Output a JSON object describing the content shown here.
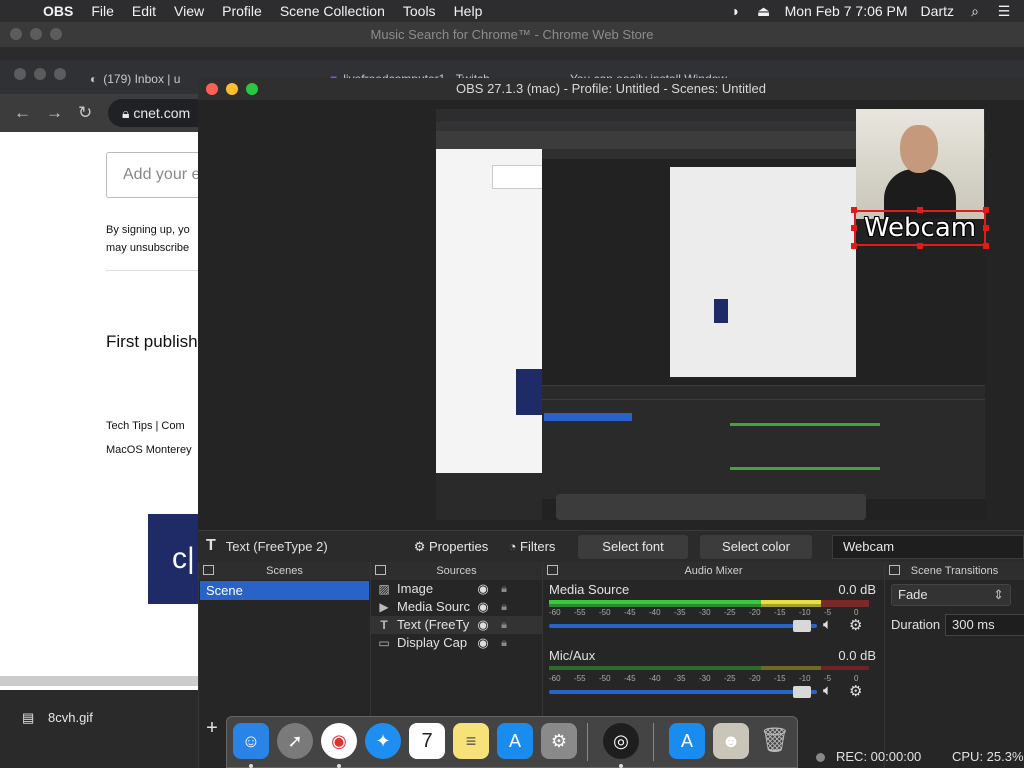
{
  "menubar": {
    "app": "OBS",
    "items": [
      "File",
      "Edit",
      "View",
      "Profile",
      "Scene Collection",
      "Tools",
      "Help"
    ],
    "datetime": "Mon Feb 7  7:06 PM",
    "user": "Dartz"
  },
  "back_window": {
    "title": "Music Search for Chrome™ - Chrome Web Store"
  },
  "chrome": {
    "tabs": [
      "(179) Inbox | u",
      "livefreedcomputer1 - Twitch",
      "You can easily install Window"
    ],
    "url": "cnet.com",
    "page": {
      "email_placeholder": "Add your e",
      "signup_line1": "By signing up, yo",
      "signup_line2": "may unsubscribe",
      "first_published": "First publish",
      "tags_line1": "Tech Tips  |  Com",
      "tags_line2": "MacOS Monterey"
    },
    "download_file": "8cvh.gif"
  },
  "obs": {
    "window_title": "OBS 27.1.3 (mac) - Profile: Untitled - Scenes: Untitled",
    "webcam_text": "Webcam",
    "selected_source": "Text (FreeType 2)",
    "buttons": {
      "properties": "Properties",
      "filters": "Filters",
      "select_font": "Select font",
      "select_color": "Select color"
    },
    "source_combo": "Webcam",
    "docks": {
      "scenes": "Scenes",
      "sources": "Sources",
      "mixer": "Audio Mixer",
      "transitions": "Scene Transitions"
    },
    "scenes": [
      "Scene"
    ],
    "sources": [
      {
        "name": "Image",
        "icon": "image-icon"
      },
      {
        "name": "Media Sourc",
        "icon": "play-icon"
      },
      {
        "name": "Text (FreeTy",
        "icon": "text-icon"
      },
      {
        "name": "Display Cap",
        "icon": "monitor-icon"
      }
    ],
    "mixer": [
      {
        "name": "Media Source",
        "db": "0.0 dB"
      },
      {
        "name": "Mic/Aux",
        "db": "0.0 dB"
      }
    ],
    "meter_ticks": [
      "-60",
      "-55",
      "-50",
      "-45",
      "-40",
      "-35",
      "-30",
      "-25",
      "-20",
      "-15",
      "-10",
      "-5",
      "0"
    ],
    "transition": "Fade",
    "duration_label": "Duration",
    "duration_value": "300 ms",
    "rec": "REC: 00:00:00",
    "cpu": "CPU: 25.3%"
  },
  "colors": {
    "accent": "#2a63c8",
    "selection": "#e01b1b"
  }
}
